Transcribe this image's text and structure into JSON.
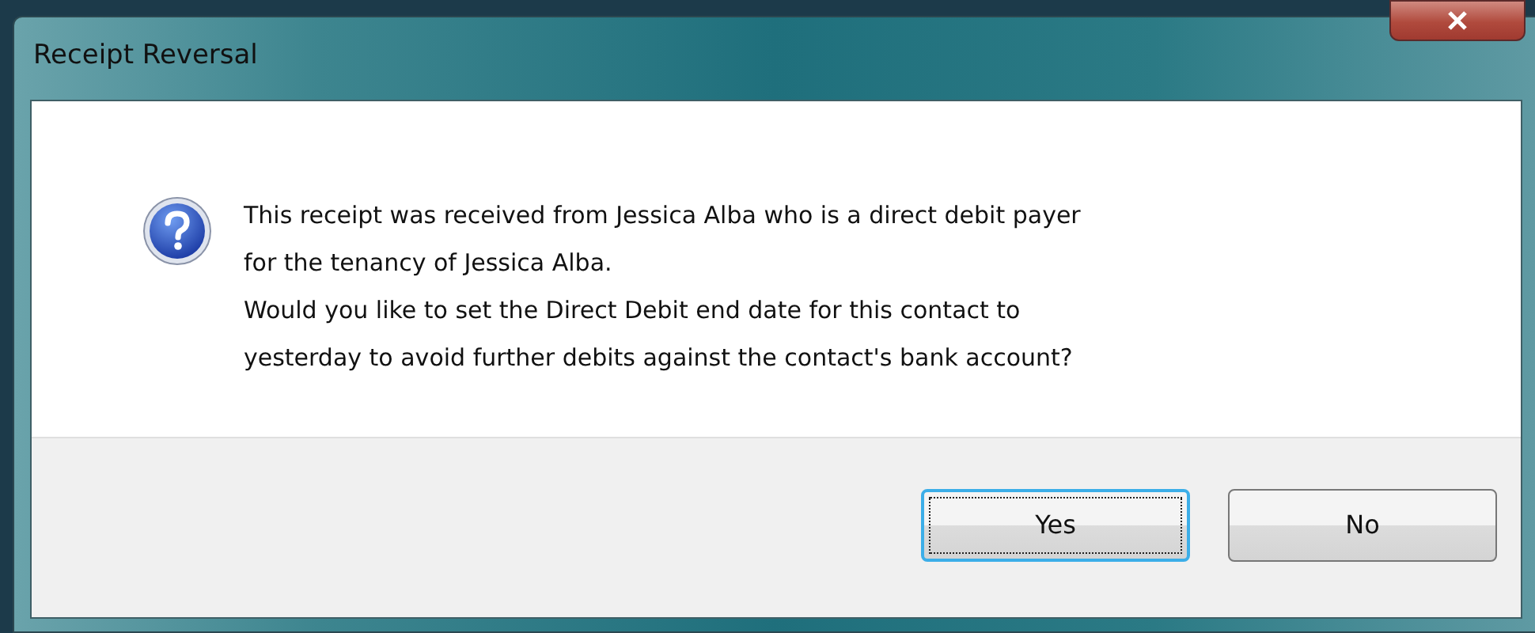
{
  "window": {
    "title": "Receipt Reversal"
  },
  "message": {
    "lines": [
      "This receipt was received from Jessica Alba who is a direct debit payer",
      "for the tenancy of Jessica Alba.",
      "Would you like to set the Direct Debit end date for this contact to",
      "yesterday to avoid further debits against the contact's bank account?"
    ]
  },
  "buttons": [
    {
      "label": "Yes",
      "selected": true
    },
    {
      "label": "No",
      "selected": false
    }
  ]
}
